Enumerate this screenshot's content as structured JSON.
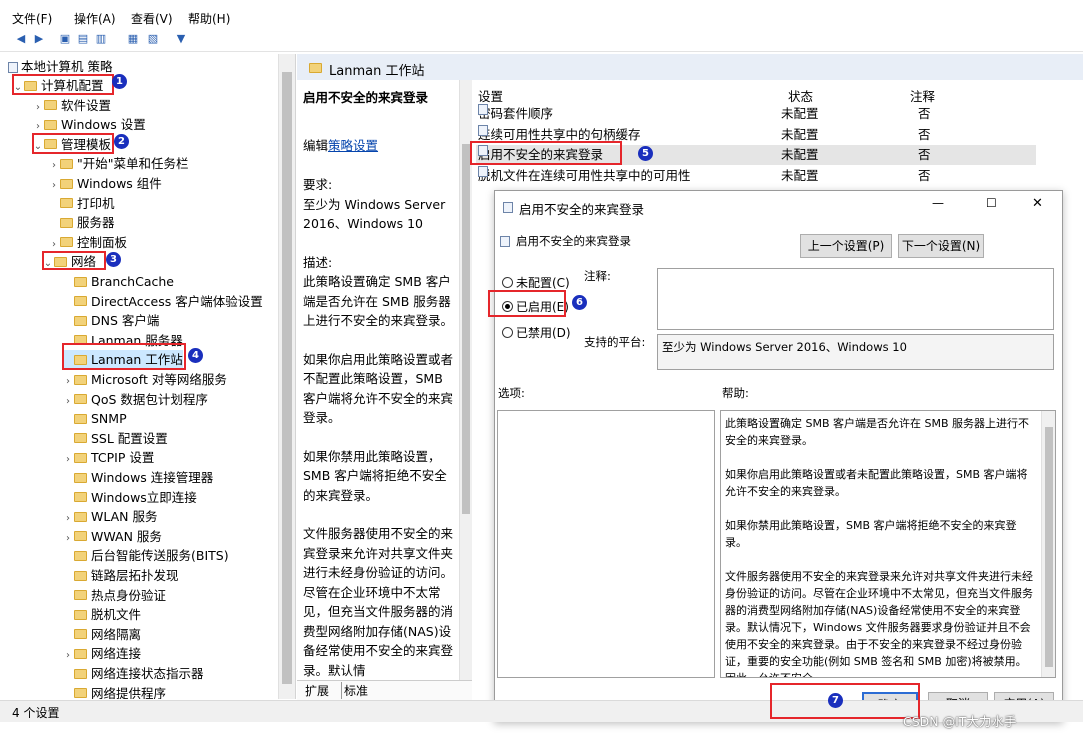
{
  "menu": [
    "文件(F)",
    "操作(A)",
    "查看(V)",
    "帮助(H)"
  ],
  "tree": {
    "root": "本地计算机 策略",
    "items": [
      {
        "label": "计算机配置",
        "arrow": "v"
      },
      {
        "label": "软件设置",
        "arrow": ">"
      },
      {
        "label": "Windows 设置",
        "arrow": ">"
      },
      {
        "label": "管理模板",
        "arrow": "v"
      },
      {
        "label": "\"开始\"菜单和任务栏",
        "arrow": ">"
      },
      {
        "label": "Windows 组件",
        "arrow": ">"
      },
      {
        "label": "打印机",
        "arrow": ""
      },
      {
        "label": "服务器",
        "arrow": ""
      },
      {
        "label": "控制面板",
        "arrow": ">"
      },
      {
        "label": "网络",
        "arrow": "v"
      },
      {
        "label": "BranchCache",
        "arrow": ""
      },
      {
        "label": "DirectAccess 客户端体验设置",
        "arrow": ""
      },
      {
        "label": "DNS 客户端",
        "arrow": ""
      },
      {
        "label": "Lanman 服务器",
        "arrow": ""
      },
      {
        "label": "Lanman 工作站",
        "arrow": ""
      },
      {
        "label": "Microsoft 对等网络服务",
        "arrow": ">"
      },
      {
        "label": "QoS 数据包计划程序",
        "arrow": ">"
      },
      {
        "label": "SNMP",
        "arrow": ""
      },
      {
        "label": "SSL 配置设置",
        "arrow": ""
      },
      {
        "label": "TCPIP 设置",
        "arrow": ">"
      },
      {
        "label": "Windows 连接管理器",
        "arrow": ""
      },
      {
        "label": "Windows立即连接",
        "arrow": ""
      },
      {
        "label": "WLAN 服务",
        "arrow": ">"
      },
      {
        "label": "WWAN 服务",
        "arrow": ">"
      },
      {
        "label": "后台智能传送服务(BITS)",
        "arrow": ""
      },
      {
        "label": "链路层拓扑发现",
        "arrow": ""
      },
      {
        "label": "热点身份验证",
        "arrow": ""
      },
      {
        "label": "脱机文件",
        "arrow": ""
      },
      {
        "label": "网络隔离",
        "arrow": ""
      },
      {
        "label": "网络连接",
        "arrow": ">"
      },
      {
        "label": "网络连接状态指示器",
        "arrow": ""
      },
      {
        "label": "网络提供程序",
        "arrow": ""
      }
    ]
  },
  "header": {
    "title": "Lanman 工作站"
  },
  "description": {
    "title": "启用不安全的来宾登录",
    "edit_prefix": "编辑",
    "edit_link": "策略设置",
    "req_label": "要求:",
    "req_text": "至少为 Windows Server 2016、Windows 10",
    "desc_label": "描述:",
    "p1": "此策略设置确定 SMB 客户端是否允许在 SMB 服务器上进行不安全的来宾登录。",
    "p2": "如果你启用此策略设置或者不配置此策略设置，SMB 客户端将允许不安全的来宾登录。",
    "p3": "如果你禁用此策略设置，SMB 客户端将拒绝不安全的来宾登录。",
    "p4": "文件服务器使用不安全的来宾登录来允许对共享文件夹进行未经身份验证的访问。尽管在企业环境中不太常见，但充当文件服务器的消费型网络附加存储(NAS)设备经常使用不安全的来宾登录。默认情"
  },
  "tabs": [
    "扩展",
    "标准"
  ],
  "list": {
    "columns": [
      "设置",
      "状态",
      "注释"
    ],
    "rows": [
      {
        "name": "密码套件顺序",
        "state": "未配置",
        "note": "否"
      },
      {
        "name": "连续可用性共享中的句柄缓存",
        "state": "未配置",
        "note": "否"
      },
      {
        "name": "启用不安全的来宾登录",
        "state": "未配置",
        "note": "否"
      },
      {
        "name": "脱机文件在连续可用性共享中的可用性",
        "state": "未配置",
        "note": "否"
      }
    ]
  },
  "dialog": {
    "title": "启用不安全的来宾登录",
    "subtitle": "启用不安全的来宾登录",
    "prev_btn": "上一个设置(P)",
    "next_btn": "下一个设置(N)",
    "radio_not_configured": "未配置(C)",
    "radio_enabled": "已启用(E)",
    "radio_disabled": "已禁用(D)",
    "comment_label": "注释:",
    "platform_label": "支持的平台:",
    "platform_value": "至少为 Windows Server 2016、Windows 10",
    "options_label": "选项:",
    "help_label": "帮助:",
    "help_p1": "此策略设置确定 SMB 客户端是否允许在 SMB 服务器上进行不安全的来宾登录。",
    "help_p2": "如果你启用此策略设置或者未配置此策略设置，SMB 客户端将允许不安全的来宾登录。",
    "help_p3": "如果你禁用此策略设置，SMB 客户端将拒绝不安全的来宾登录。",
    "help_p4": "文件服务器使用不安全的来宾登录来允许对共享文件夹进行未经身份验证的访问。尽管在企业环境中不太常见，但充当文件服务器的消费型网络附加存储(NAS)设备经常使用不安全的来宾登录。默认情况下，Windows 文件服务器要求身份验证并且不会使用不安全的来宾登录。由于不安全的来宾登录不经过身份验证，重要的安全功能(例如 SMB 签名和 SMB 加密)将被禁用。因此，允许不安全",
    "ok_btn": "确定",
    "cancel_btn": "取消",
    "apply_btn": "应用(A)",
    "minimize": "—",
    "maximize": "☐",
    "close": "✕"
  },
  "status": "4 个设置",
  "badges": [
    "1",
    "2",
    "3",
    "4",
    "5",
    "6",
    "7"
  ],
  "watermark": "CSDN @IT大力水手",
  "colors": {
    "annotation_red": "#e5262b",
    "badge_blue": "#1a2fbd",
    "selection": "#e5e5e5"
  }
}
